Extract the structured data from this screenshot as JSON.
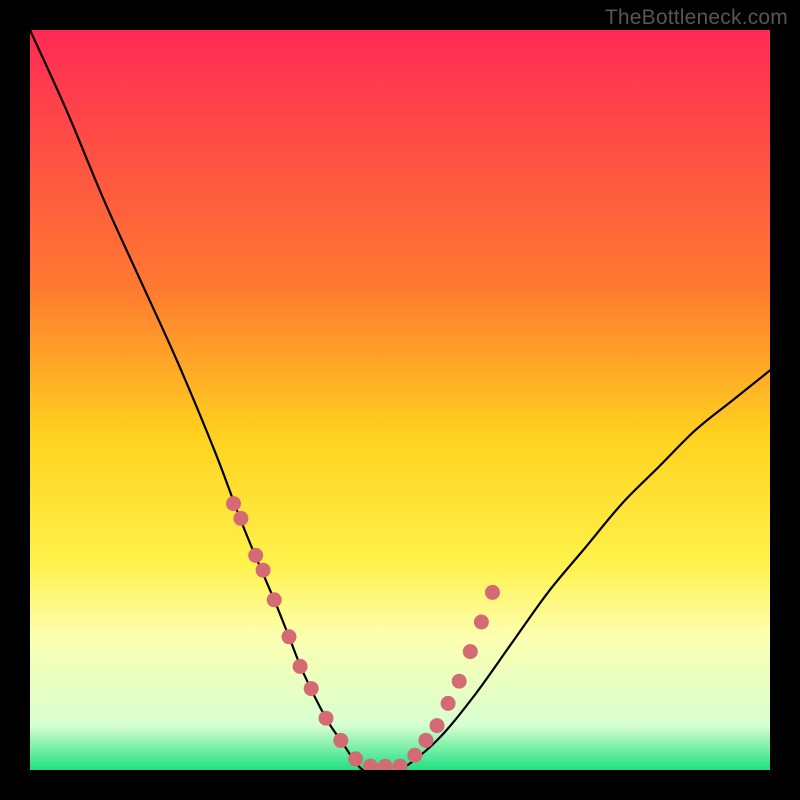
{
  "watermark": "TheBottleneck.com",
  "chart_data": {
    "type": "line",
    "title": "",
    "xlabel": "",
    "ylabel": "",
    "xlim": [
      0,
      100
    ],
    "ylim": [
      0,
      100
    ],
    "background_gradient": {
      "stops": [
        {
          "offset": 0,
          "color": "#ff2a55"
        },
        {
          "offset": 35,
          "color": "#ff7a30"
        },
        {
          "offset": 55,
          "color": "#ffd21f"
        },
        {
          "offset": 72,
          "color": "#fff24a"
        },
        {
          "offset": 82,
          "color": "#fdffb0"
        },
        {
          "offset": 94,
          "color": "#d7ffd0"
        },
        {
          "offset": 100,
          "color": "#1fe082"
        }
      ]
    },
    "series": [
      {
        "name": "bottleneck-curve",
        "x": [
          0,
          5,
          10,
          15,
          20,
          25,
          28,
          30,
          33,
          35,
          37,
          40,
          42,
          45,
          48,
          50,
          55,
          60,
          65,
          70,
          75,
          80,
          85,
          90,
          95,
          100
        ],
        "y": [
          100,
          89,
          77,
          66,
          55,
          43,
          35,
          30,
          23,
          18,
          13,
          7,
          4,
          0,
          0,
          0,
          4,
          10,
          17,
          24,
          30,
          36,
          41,
          46,
          50,
          54
        ]
      }
    ],
    "markers": {
      "name": "highlight-points",
      "color": "#d46a74",
      "x": [
        27.5,
        28.5,
        30.5,
        31.5,
        33.0,
        35.0,
        36.5,
        38.0,
        40.0,
        42.0,
        44.0,
        46.0,
        48.0,
        50.0,
        52.0,
        53.5,
        55.0,
        56.5,
        58.0,
        59.5,
        61.0,
        62.5
      ],
      "y": [
        36,
        34,
        29,
        27,
        23,
        18,
        14,
        11,
        7,
        4,
        1.5,
        0.5,
        0.5,
        0.5,
        2,
        4,
        6,
        9,
        12,
        16,
        20,
        24
      ]
    }
  }
}
